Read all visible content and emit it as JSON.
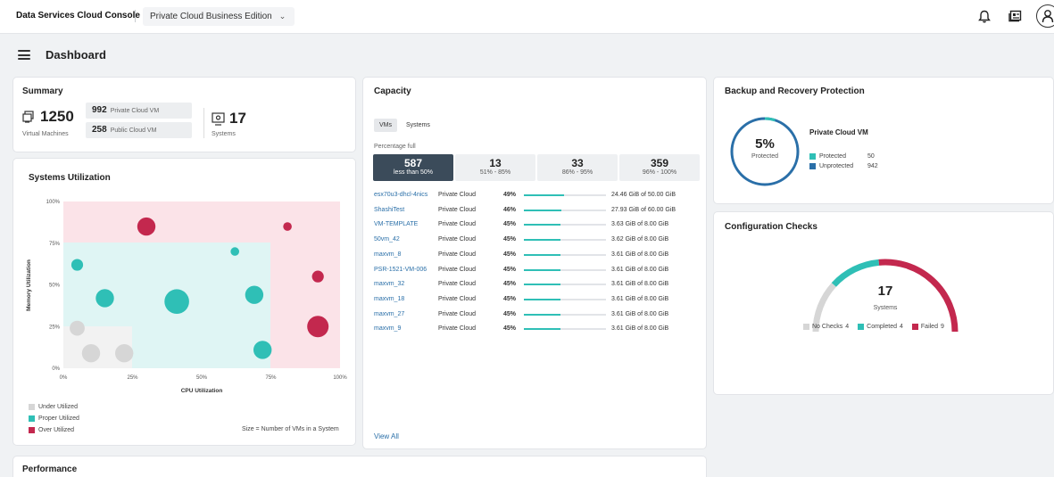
{
  "topbar": {
    "brand": "Data Services Cloud Console",
    "separator": "|",
    "edition": "Private Cloud Business Edition",
    "edition_chevron": "⌄"
  },
  "header": {
    "title": "Dashboard"
  },
  "summary": {
    "title": "Summary",
    "vm_count": "1250",
    "vm_label": "Virtual Machines",
    "private_count": "992",
    "private_label": "Private Cloud VM",
    "public_count": "258",
    "public_label": "Public Cloud VM",
    "systems_count": "17",
    "systems_label": "Systems"
  },
  "systems_utilization": {
    "title": "Systems Utilization",
    "size_note": "Size = Number of VMs in a System",
    "legend": [
      "Under Utilized",
      "Proper Utilized",
      "Over Utilized"
    ]
  },
  "colors": {
    "under": "#d6d6d6",
    "proper": "#2fbfb6",
    "over": "#c3284e",
    "accent": "#2a6fa8",
    "dark": "#3b4b5a"
  },
  "chart_data": {
    "type": "scatter",
    "xlabel": "CPU Utilization",
    "ylabel": "Memory Utilization",
    "xlim": [
      0,
      100
    ],
    "ylim": [
      0,
      100
    ],
    "x_ticks": [
      "0%",
      "25%",
      "50%",
      "75%",
      "100%"
    ],
    "y_ticks": [
      "0%",
      "25%",
      "50%",
      "75%",
      "100%"
    ],
    "series": [
      {
        "name": "Under Utilized",
        "points": [
          {
            "x": 5,
            "y": 24,
            "size": 3
          },
          {
            "x": 10,
            "y": 9,
            "size": 4
          },
          {
            "x": 22,
            "y": 9,
            "size": 4
          }
        ]
      },
      {
        "name": "Proper Utilized",
        "points": [
          {
            "x": 5,
            "y": 62,
            "size": 2
          },
          {
            "x": 15,
            "y": 42,
            "size": 4
          },
          {
            "x": 41,
            "y": 40,
            "size": 6
          },
          {
            "x": 62,
            "y": 70,
            "size": 1
          },
          {
            "x": 69,
            "y": 44,
            "size": 4
          },
          {
            "x": 72,
            "y": 11,
            "size": 4
          }
        ]
      },
      {
        "name": "Over Utilized",
        "points": [
          {
            "x": 30,
            "y": 85,
            "size": 4
          },
          {
            "x": 81,
            "y": 85,
            "size": 1
          },
          {
            "x": 92,
            "y": 55,
            "size": 2
          },
          {
            "x": 92,
            "y": 25,
            "size": 5
          }
        ]
      }
    ]
  },
  "capacity": {
    "title": "Capacity",
    "tabs": [
      "VMs",
      "Systems"
    ],
    "percentage_full_label": "Percentage full",
    "buckets": [
      {
        "count": "587",
        "label": "less than 50%"
      },
      {
        "count": "13",
        "label": "51% - 85%"
      },
      {
        "count": "33",
        "label": "86% - 95%"
      },
      {
        "count": "359",
        "label": "96% - 100%"
      }
    ],
    "vms": [
      {
        "name": "esx70u3-dhcl-4nics",
        "type": "Private Cloud",
        "pct": "49%",
        "fill": 0.49,
        "usage": "24.46 GiB of 50.00 GiB"
      },
      {
        "name": "ShashiTest",
        "type": "Private Cloud",
        "pct": "46%",
        "fill": 0.46,
        "usage": "27.93 GiB of 60.00 GiB"
      },
      {
        "name": "VM-TEMPLATE",
        "type": "Private Cloud",
        "pct": "45%",
        "fill": 0.45,
        "usage": "3.63 GiB of 8.00 GiB"
      },
      {
        "name": "50vm_42",
        "type": "Private Cloud",
        "pct": "45%",
        "fill": 0.45,
        "usage": "3.62 GiB of 8.00 GiB"
      },
      {
        "name": "maxvm_8",
        "type": "Private Cloud",
        "pct": "45%",
        "fill": 0.45,
        "usage": "3.61 GiB of 8.00 GiB"
      },
      {
        "name": "PSR-1521-VM-006",
        "type": "Private Cloud",
        "pct": "45%",
        "fill": 0.45,
        "usage": "3.61 GiB of 8.00 GiB"
      },
      {
        "name": "maxvm_32",
        "type": "Private Cloud",
        "pct": "45%",
        "fill": 0.45,
        "usage": "3.61 GiB of 8.00 GiB"
      },
      {
        "name": "maxvm_18",
        "type": "Private Cloud",
        "pct": "45%",
        "fill": 0.45,
        "usage": "3.61 GiB of 8.00 GiB"
      },
      {
        "name": "maxvm_27",
        "type": "Private Cloud",
        "pct": "45%",
        "fill": 0.45,
        "usage": "3.61 GiB of 8.00 GiB"
      },
      {
        "name": "maxvm_9",
        "type": "Private Cloud",
        "pct": "45%",
        "fill": 0.45,
        "usage": "3.61 GiB of 8.00 GiB"
      }
    ],
    "view_all": "View All"
  },
  "backup": {
    "title": "Backup and Recovery Protection",
    "percent": "5%",
    "percent_label": "Protected",
    "protected_fraction": 0.05,
    "series_title": "Private Cloud VM",
    "protected_label": "Protected",
    "protected_count": "50",
    "unprotected_label": "Unprotected",
    "unprotected_count": "942"
  },
  "config_checks": {
    "title": "Configuration Checks",
    "total": "17",
    "total_label": "Systems",
    "no_checks_label": "No Checks",
    "no_checks": 4,
    "completed_label": "Completed",
    "completed": 4,
    "failed_label": "Failed",
    "failed": 9
  },
  "performance": {
    "title": "Performance"
  }
}
